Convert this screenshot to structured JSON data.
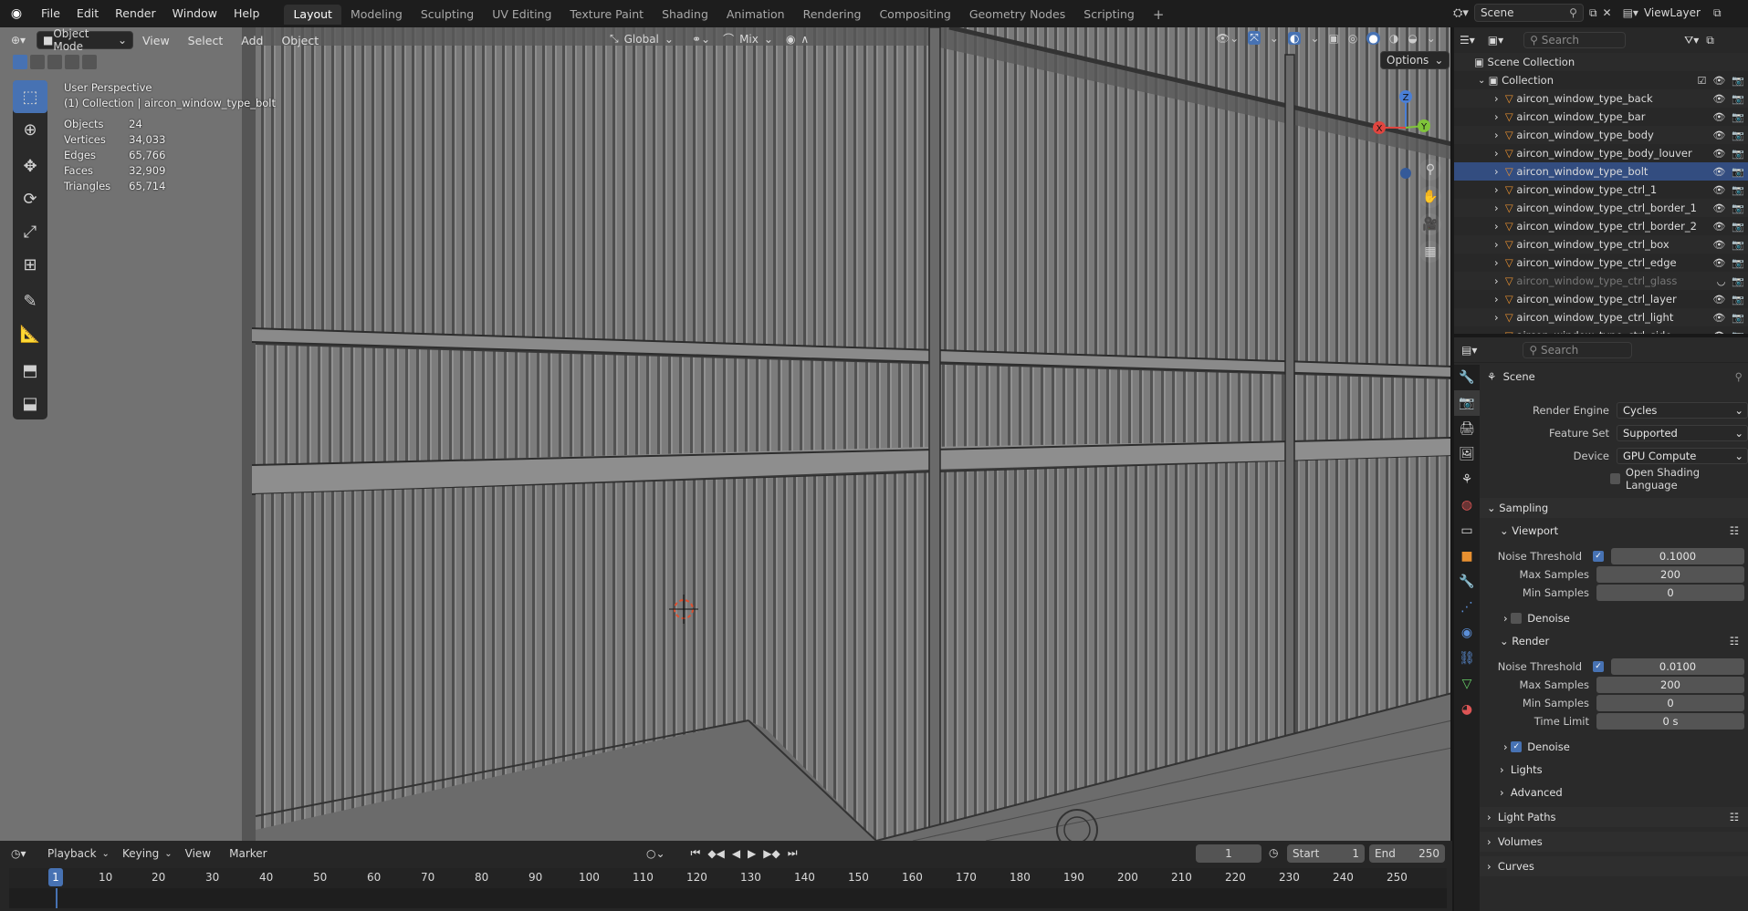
{
  "topbar": {
    "menus": [
      "File",
      "Edit",
      "Render",
      "Window",
      "Help"
    ],
    "workspaces": [
      "Layout",
      "Modeling",
      "Sculpting",
      "UV Editing",
      "Texture Paint",
      "Shading",
      "Animation",
      "Rendering",
      "Compositing",
      "Geometry Nodes",
      "Scripting"
    ],
    "add_tab": "+",
    "scene": "Scene",
    "view_layer": "ViewLayer"
  },
  "viewport_header": {
    "mode": "Object Mode",
    "menus": [
      "View",
      "Select",
      "Add",
      "Object"
    ],
    "transform_orientation": "Global",
    "snap_mode": "Mix",
    "options": "Options"
  },
  "overlay": {
    "view_name": "User Perspective",
    "collection_info": "(1) Collection | aircon_window_type_bolt",
    "stats": [
      {
        "label": "Objects",
        "value": "24"
      },
      {
        "label": "Vertices",
        "value": "34,033"
      },
      {
        "label": "Edges",
        "value": "65,766"
      },
      {
        "label": "Faces",
        "value": "32,909"
      },
      {
        "label": "Triangles",
        "value": "65,714"
      }
    ]
  },
  "gizmo": {
    "x": "X",
    "y": "Y",
    "z": "Z",
    "x_color": "#e0453f",
    "y_color": "#7fc43a",
    "z_color": "#4a7fd6"
  },
  "timeline": {
    "menus": [
      "Playback",
      "Keying",
      "View",
      "Marker"
    ],
    "current_frame": "1",
    "start_label": "Start",
    "start": "1",
    "end_label": "End",
    "end": "250",
    "ticks": [
      "1",
      "10",
      "20",
      "30",
      "40",
      "50",
      "60",
      "70",
      "80",
      "90",
      "100",
      "110",
      "120",
      "130",
      "140",
      "150",
      "160",
      "170",
      "180",
      "190",
      "200",
      "210",
      "220",
      "230",
      "240",
      "250"
    ]
  },
  "outliner": {
    "search_placeholder": "Search",
    "root": "Scene Collection",
    "collection": "Collection",
    "items": [
      {
        "name": "aircon_window_type_back",
        "dim": false,
        "hidden": false
      },
      {
        "name": "aircon_window_type_bar",
        "dim": false,
        "hidden": false
      },
      {
        "name": "aircon_window_type_body",
        "dim": false,
        "hidden": false
      },
      {
        "name": "aircon_window_type_body_louver",
        "dim": false,
        "hidden": false
      },
      {
        "name": "aircon_window_type_bolt",
        "dim": false,
        "hidden": false
      },
      {
        "name": "aircon_window_type_ctrl_1",
        "dim": false,
        "hidden": false
      },
      {
        "name": "aircon_window_type_ctrl_border_1",
        "dim": false,
        "hidden": false
      },
      {
        "name": "aircon_window_type_ctrl_border_2",
        "dim": false,
        "hidden": false
      },
      {
        "name": "aircon_window_type_ctrl_box",
        "dim": false,
        "hidden": false
      },
      {
        "name": "aircon_window_type_ctrl_edge",
        "dim": false,
        "hidden": false
      },
      {
        "name": "aircon_window_type_ctrl_glass",
        "dim": true,
        "hidden": true
      },
      {
        "name": "aircon_window_type_ctrl_layer",
        "dim": false,
        "hidden": false
      },
      {
        "name": "aircon_window_type_ctrl_light",
        "dim": false,
        "hidden": false
      },
      {
        "name": "aircon_window_type_ctrl_side",
        "dim": false,
        "hidden": false
      }
    ]
  },
  "properties": {
    "search_placeholder": "Search",
    "context": "Scene",
    "render_engine_label": "Render Engine",
    "render_engine": "Cycles",
    "feature_set_label": "Feature Set",
    "feature_set": "Supported",
    "device_label": "Device",
    "device": "GPU Compute",
    "osl_label": "Open Shading Language",
    "sampling": "Sampling",
    "viewport": "Viewport",
    "noise_threshold_label": "Noise Threshold",
    "vp_noise_threshold": "0.1000",
    "max_samples_label": "Max Samples",
    "vp_max_samples": "200",
    "min_samples_label": "Min Samples",
    "vp_min_samples": "0",
    "denoise_label": "Denoise",
    "render": "Render",
    "r_noise_threshold": "0.0100",
    "r_max_samples": "200",
    "r_min_samples": "0",
    "time_limit_label": "Time Limit",
    "r_time_limit": "0 s",
    "lights": "Lights",
    "advanced": "Advanced",
    "light_paths": "Light Paths",
    "volumes": "Volumes",
    "curves": "Curves"
  }
}
